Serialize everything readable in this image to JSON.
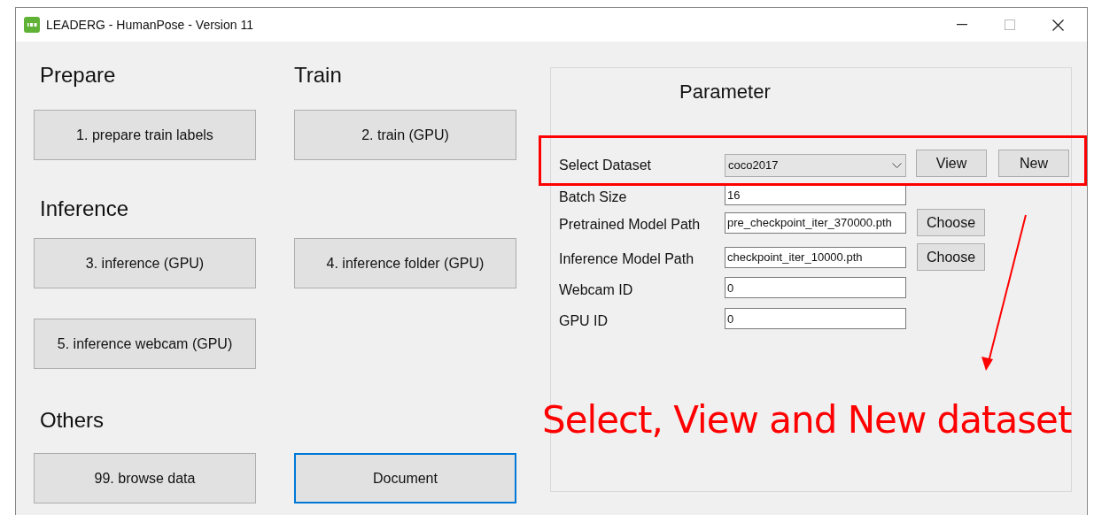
{
  "window": {
    "title": "LEADERG - HumanPose - Version 11"
  },
  "groups": [
    {
      "headings": [
        "Prepare",
        "Train"
      ],
      "button_rows": [
        [
          {
            "label": "1. prepare train labels",
            "focused": false
          },
          {
            "label": "2. train (GPU)",
            "focused": false
          }
        ]
      ]
    },
    {
      "headings": [
        "Inference"
      ],
      "button_rows": [
        [
          {
            "label": "3. inference (GPU)",
            "focused": false
          },
          {
            "label": "4. inference folder (GPU)",
            "focused": false
          }
        ],
        [
          {
            "label": "5. inference webcam (GPU)",
            "focused": false
          }
        ]
      ]
    },
    {
      "headings": [
        "Others"
      ],
      "button_rows": [
        [
          {
            "label": "99. browse data",
            "focused": false
          },
          {
            "label": "Document",
            "focused": true
          }
        ]
      ]
    }
  ],
  "parameter": {
    "title": "Parameter",
    "rows": [
      {
        "kind": "dropdown",
        "label": "Select Dataset",
        "value": "coco2017",
        "buttons": [
          "View",
          "New"
        ]
      },
      {
        "kind": "text",
        "label": "Batch Size",
        "value": "16"
      },
      {
        "kind": "text",
        "label": "Pretrained Model Path",
        "value": "pre_checkpoint_iter_370000.pth",
        "buttons": [
          "Choose"
        ]
      },
      {
        "kind": "text",
        "label": "Inference Model Path",
        "value": "checkpoint_iter_10000.pth",
        "buttons": [
          "Choose"
        ]
      },
      {
        "kind": "text",
        "label": "Webcam ID",
        "value": "0"
      },
      {
        "kind": "text",
        "label": "GPU ID",
        "value": "0"
      }
    ]
  },
  "annotation": {
    "caption": "Select, View and New dataset"
  }
}
